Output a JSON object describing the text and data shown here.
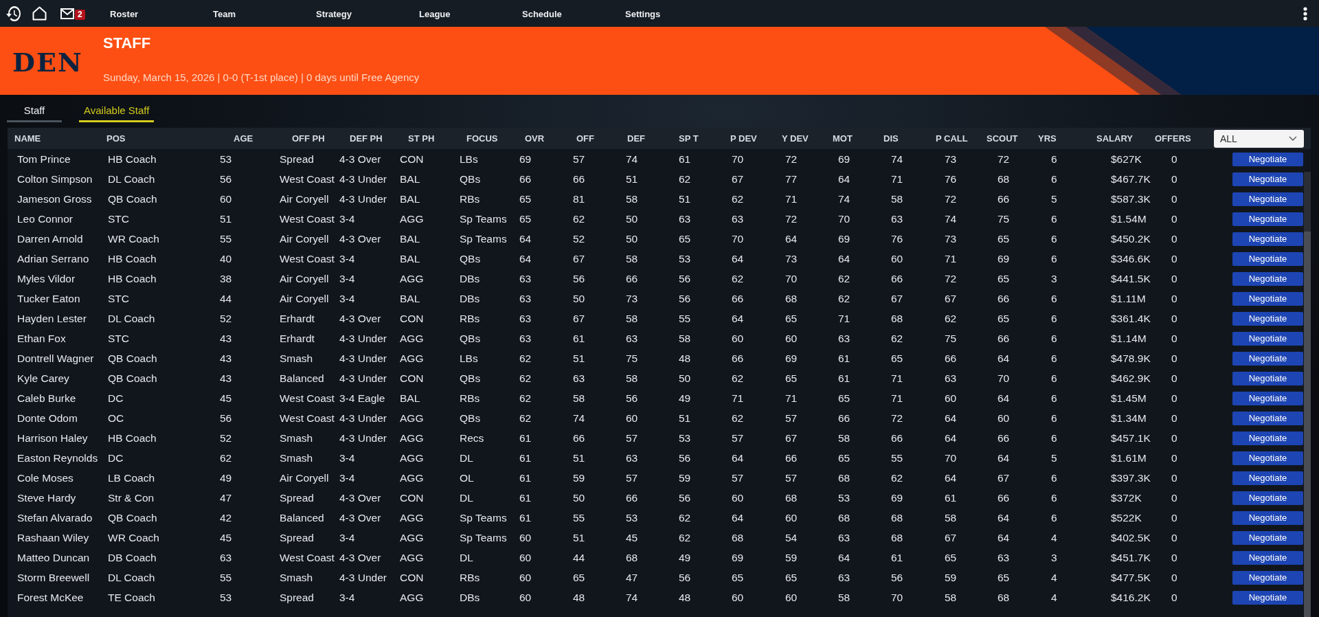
{
  "top_bar": {
    "mail_badge": "2",
    "menu": [
      "Roster",
      "Team",
      "Strategy",
      "League",
      "Schedule",
      "Settings"
    ]
  },
  "header": {
    "logo": "DEN",
    "title": "STAFF",
    "subtitle": "Sunday, March 15, 2026 | 0-0 (T-1st place) | 0 days until Free Agency"
  },
  "tabs": [
    {
      "label": "Staff",
      "selected": false
    },
    {
      "label": "Available Staff",
      "selected": true
    }
  ],
  "table": {
    "columns": [
      "NAME",
      "POS",
      "AGE",
      "OFF PH",
      "DEF PH",
      "ST PH",
      "FOCUS",
      "OVR",
      "OFF",
      "DEF",
      "SP T",
      "P DEV",
      "Y DEV",
      "MOT",
      "DIS",
      "P CALL",
      "SCOUT",
      "YRS",
      "SALARY",
      "OFFERS"
    ],
    "filter": {
      "value": "ALL"
    },
    "rows": [
      {
        "cells": [
          "Tom Prince",
          "HB Coach",
          "53",
          "Spread",
          "4-3 Over",
          "CON",
          "LBs",
          "69",
          "57",
          "74",
          "61",
          "70",
          "72",
          "69",
          "74",
          "73",
          "72",
          "6",
          "$627K",
          "0"
        ],
        "action": "Negotiate"
      },
      {
        "cells": [
          "Colton Simpson",
          "DL Coach",
          "56",
          "West Coast",
          "4-3 Under",
          "BAL",
          "QBs",
          "66",
          "66",
          "51",
          "62",
          "67",
          "77",
          "64",
          "71",
          "76",
          "68",
          "6",
          "$467.7K",
          "0"
        ],
        "action": "Negotiate"
      },
      {
        "cells": [
          "Jameson Gross",
          "QB Coach",
          "60",
          "Air Coryell",
          "4-3 Under",
          "BAL",
          "RBs",
          "65",
          "81",
          "58",
          "51",
          "62",
          "71",
          "74",
          "58",
          "72",
          "66",
          "5",
          "$587.3K",
          "0"
        ],
        "action": "Negotiate"
      },
      {
        "cells": [
          "Leo Connor",
          "STC",
          "51",
          "West Coast",
          "3-4",
          "AGG",
          "Sp Teams",
          "65",
          "62",
          "50",
          "63",
          "63",
          "72",
          "70",
          "63",
          "74",
          "75",
          "6",
          "$1.54M",
          "0"
        ],
        "action": "Negotiate"
      },
      {
        "cells": [
          "Darren Arnold",
          "WR Coach",
          "55",
          "Air Coryell",
          "4-3 Over",
          "BAL",
          "Sp Teams",
          "64",
          "52",
          "50",
          "65",
          "70",
          "64",
          "69",
          "76",
          "73",
          "65",
          "6",
          "$450.2K",
          "0"
        ],
        "action": "Negotiate"
      },
      {
        "cells": [
          "Adrian Serrano",
          "HB Coach",
          "40",
          "West Coast",
          "3-4",
          "BAL",
          "QBs",
          "64",
          "67",
          "58",
          "53",
          "64",
          "73",
          "64",
          "60",
          "71",
          "69",
          "6",
          "$346.6K",
          "0"
        ],
        "action": "Negotiate"
      },
      {
        "cells": [
          "Myles Vildor",
          "HB Coach",
          "38",
          "Air Coryell",
          "3-4",
          "AGG",
          "DBs",
          "63",
          "56",
          "66",
          "56",
          "62",
          "70",
          "62",
          "66",
          "72",
          "65",
          "3",
          "$441.5K",
          "0"
        ],
        "action": "Negotiate"
      },
      {
        "cells": [
          "Tucker Eaton",
          "STC",
          "44",
          "Air Coryell",
          "3-4",
          "BAL",
          "DBs",
          "63",
          "50",
          "73",
          "56",
          "66",
          "68",
          "62",
          "67",
          "67",
          "66",
          "6",
          "$1.11M",
          "0"
        ],
        "action": "Negotiate"
      },
      {
        "cells": [
          "Hayden Lester",
          "DL Coach",
          "52",
          "Erhardt",
          "4-3 Over",
          "CON",
          "RBs",
          "63",
          "67",
          "58",
          "55",
          "64",
          "65",
          "71",
          "68",
          "62",
          "65",
          "6",
          "$361.4K",
          "0"
        ],
        "action": "Negotiate"
      },
      {
        "cells": [
          "Ethan Fox",
          "STC",
          "43",
          "Erhardt",
          "4-3 Under",
          "AGG",
          "QBs",
          "63",
          "61",
          "63",
          "58",
          "60",
          "60",
          "63",
          "62",
          "75",
          "66",
          "6",
          "$1.14M",
          "0"
        ],
        "action": "Negotiate"
      },
      {
        "cells": [
          "Dontrell Wagner",
          "QB Coach",
          "43",
          "Smash",
          "4-3 Under",
          "AGG",
          "LBs",
          "62",
          "51",
          "75",
          "48",
          "66",
          "69",
          "61",
          "65",
          "66",
          "64",
          "6",
          "$478.9K",
          "0"
        ],
        "action": "Negotiate"
      },
      {
        "cells": [
          "Kyle Carey",
          "QB Coach",
          "43",
          "Balanced",
          "4-3 Under",
          "CON",
          "QBs",
          "62",
          "63",
          "58",
          "50",
          "62",
          "65",
          "61",
          "71",
          "63",
          "70",
          "6",
          "$462.9K",
          "0"
        ],
        "action": "Negotiate"
      },
      {
        "cells": [
          "Caleb Burke",
          "DC",
          "45",
          "West Coast",
          "3-4 Eagle",
          "BAL",
          "RBs",
          "62",
          "58",
          "56",
          "49",
          "71",
          "71",
          "65",
          "71",
          "60",
          "64",
          "6",
          "$1.45M",
          "0"
        ],
        "action": "Negotiate"
      },
      {
        "cells": [
          "Donte Odom",
          "OC",
          "56",
          "West Coast",
          "4-3 Under",
          "AGG",
          "QBs",
          "62",
          "74",
          "60",
          "51",
          "62",
          "57",
          "66",
          "72",
          "64",
          "60",
          "6",
          "$1.34M",
          "0"
        ],
        "action": "Negotiate"
      },
      {
        "cells": [
          "Harrison Haley",
          "HB Coach",
          "52",
          "Smash",
          "4-3 Under",
          "AGG",
          "Recs",
          "61",
          "66",
          "57",
          "53",
          "57",
          "67",
          "58",
          "66",
          "64",
          "66",
          "6",
          "$457.1K",
          "0"
        ],
        "action": "Negotiate"
      },
      {
        "cells": [
          "Easton Reynolds",
          "DC",
          "62",
          "Smash",
          "3-4",
          "AGG",
          "DL",
          "61",
          "51",
          "63",
          "56",
          "64",
          "66",
          "65",
          "55",
          "70",
          "64",
          "5",
          "$1.61M",
          "0"
        ],
        "action": "Negotiate"
      },
      {
        "cells": [
          "Cole Moses",
          "LB Coach",
          "49",
          "Air Coryell",
          "3-4",
          "AGG",
          "OL",
          "61",
          "59",
          "57",
          "59",
          "57",
          "57",
          "68",
          "62",
          "64",
          "67",
          "6",
          "$397.3K",
          "0"
        ],
        "action": "Negotiate"
      },
      {
        "cells": [
          "Steve Hardy",
          "Str & Con",
          "47",
          "Spread",
          "4-3 Over",
          "CON",
          "DL",
          "61",
          "50",
          "66",
          "56",
          "60",
          "68",
          "53",
          "69",
          "61",
          "66",
          "6",
          "$372K",
          "0"
        ],
        "action": "Negotiate"
      },
      {
        "cells": [
          "Stefan Alvarado",
          "QB Coach",
          "42",
          "Balanced",
          "4-3 Over",
          "AGG",
          "Sp Teams",
          "61",
          "55",
          "53",
          "62",
          "64",
          "60",
          "68",
          "68",
          "58",
          "64",
          "6",
          "$522K",
          "0"
        ],
        "action": "Negotiate"
      },
      {
        "cells": [
          "Rashaan Wiley",
          "WR Coach",
          "45",
          "Spread",
          "3-4",
          "AGG",
          "Sp Teams",
          "60",
          "51",
          "45",
          "62",
          "68",
          "54",
          "63",
          "68",
          "67",
          "64",
          "4",
          "$402.5K",
          "0"
        ],
        "action": "Negotiate"
      },
      {
        "cells": [
          "Matteo Duncan",
          "DB Coach",
          "63",
          "West Coast",
          "4-3 Over",
          "AGG",
          "DL",
          "60",
          "44",
          "68",
          "49",
          "69",
          "59",
          "64",
          "61",
          "65",
          "63",
          "3",
          "$451.7K",
          "0"
        ],
        "action": "Negotiate"
      },
      {
        "cells": [
          "Storm Breewell",
          "DL Coach",
          "55",
          "Smash",
          "4-3 Under",
          "CON",
          "RBs",
          "60",
          "65",
          "47",
          "56",
          "65",
          "65",
          "63",
          "56",
          "59",
          "65",
          "4",
          "$477.5K",
          "0"
        ],
        "action": "Negotiate"
      },
      {
        "cells": [
          "Forest McKee",
          "TE Coach",
          "53",
          "Spread",
          "3-4",
          "AGG",
          "DBs",
          "60",
          "48",
          "74",
          "48",
          "60",
          "60",
          "58",
          "70",
          "58",
          "68",
          "4",
          "$416.2K",
          "0"
        ],
        "action": "Negotiate"
      }
    ]
  }
}
